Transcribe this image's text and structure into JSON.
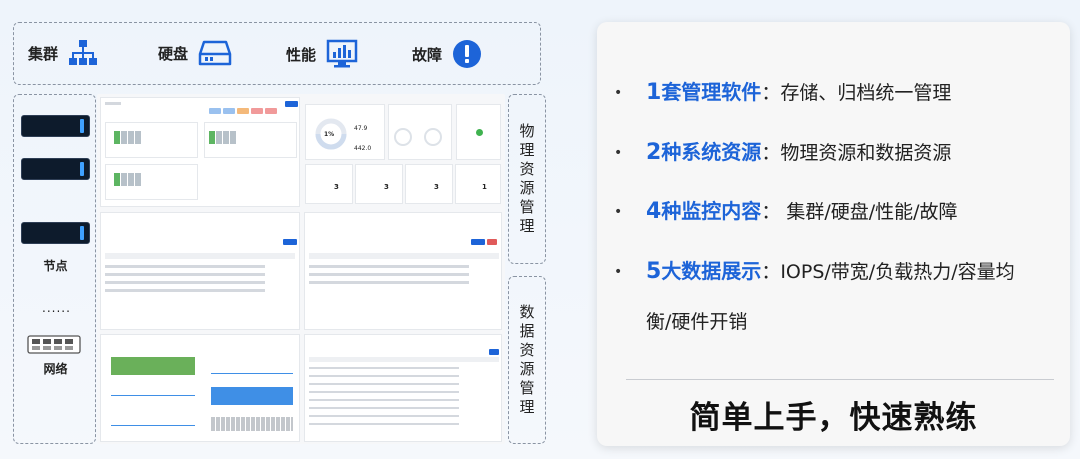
{
  "categories": [
    {
      "label": "集群",
      "icon": "cluster-icon"
    },
    {
      "label": "硬盘",
      "icon": "disk-icon"
    },
    {
      "label": "性能",
      "icon": "performance-icon"
    },
    {
      "label": "故障",
      "icon": "alert-icon"
    }
  ],
  "left": {
    "node_label": "节点",
    "network_label": "网络",
    "ellipsis": "......"
  },
  "side_labels": {
    "physical": [
      "物",
      "理",
      "资",
      "源",
      "管",
      "理"
    ],
    "data": [
      "数",
      "据",
      "资",
      "源",
      "管",
      "理"
    ]
  },
  "mock": {
    "percent": "1%",
    "v1": "47.9",
    "v2": "442.0",
    "count": "3",
    "count4": "1"
  },
  "features": [
    {
      "num": "1",
      "key": "套管理软件",
      "sep": "：",
      "desc": "存储、归档统一管理"
    },
    {
      "num": "2",
      "key": "种系统资源",
      "sep": "：",
      "desc": "物理资源和数据资源"
    },
    {
      "num": "4",
      "key": "种监控内容",
      "sep": "：",
      "desc": "集群/硬盘/性能/故障"
    },
    {
      "num": "5",
      "key": "大数据展示",
      "sep": "：",
      "desc": "IOPS/带宽/负载热力/容量均"
    }
  ],
  "feature4_line2": "衡/硬件开销",
  "slogan": "简单上手，快速熟练",
  "colors": {
    "accent": "#1d64d8",
    "node": "#0d1b2c",
    "green": "#5db562",
    "chart_green": "#6ab05a",
    "chart_blue": "#3f8fe6"
  }
}
